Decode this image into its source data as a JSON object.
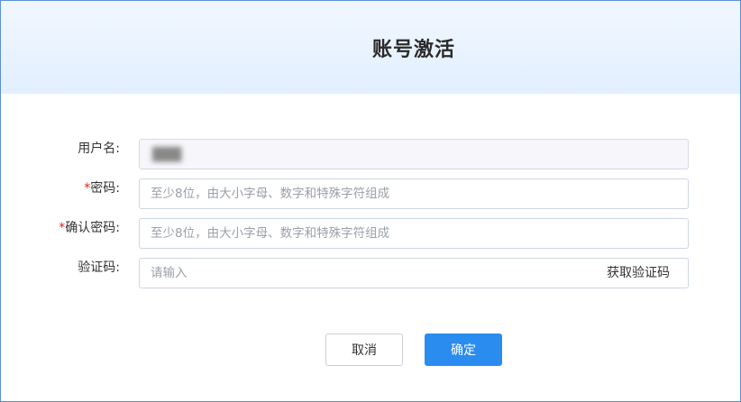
{
  "dialog": {
    "title": "账号激活"
  },
  "form": {
    "username": {
      "label": "用户名:",
      "value": "███"
    },
    "password": {
      "required_mark": "*",
      "label": "密码:",
      "placeholder": "至少8位，由大小字母、数字和特殊字符组成"
    },
    "confirm_password": {
      "required_mark": "*",
      "label": "确认密码:",
      "placeholder": "至少8位，由大小字母、数字和特殊字符组成"
    },
    "verify_code": {
      "label": "验证码:",
      "placeholder": "请输入",
      "get_code_label": "获取验证码"
    }
  },
  "actions": {
    "cancel_label": "取消",
    "confirm_label": "确定"
  },
  "colors": {
    "primary": "#2b8cf0",
    "required": "#e02020",
    "header_bg": "#e2efff"
  }
}
